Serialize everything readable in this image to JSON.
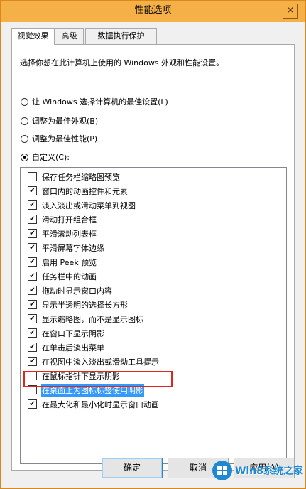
{
  "window": {
    "title": "性能选项",
    "close_glyph": "✕"
  },
  "tabs": [
    {
      "label": "视觉效果",
      "active": true
    },
    {
      "label": "高级",
      "active": false
    },
    {
      "label": "数据执行保护",
      "active": false
    }
  ],
  "intro_text": "选择你想在此计算机上使用的 Windows 外观和性能设置。",
  "radio_options": [
    {
      "label": "让 Windows 选择计算机的最佳设置(L)",
      "checked": false
    },
    {
      "label": "调整为最佳外观(B)",
      "checked": false
    },
    {
      "label": "调整为最佳性能(P)",
      "checked": false
    },
    {
      "label": "自定义(C):",
      "checked": true
    }
  ],
  "effects": [
    {
      "label": "保存任务栏缩略图预览",
      "checked": false
    },
    {
      "label": "窗口内的动画控件和元素",
      "checked": true
    },
    {
      "label": "淡入淡出或滑动菜单到视图",
      "checked": true
    },
    {
      "label": "滑动打开组合框",
      "checked": true
    },
    {
      "label": "平滑滚动列表框",
      "checked": true
    },
    {
      "label": "平滑屏幕字体边缘",
      "checked": true
    },
    {
      "label": "启用 Peek 预览",
      "checked": true
    },
    {
      "label": "任务栏中的动画",
      "checked": true
    },
    {
      "label": "拖动时显示窗口内容",
      "checked": true
    },
    {
      "label": "显示半透明的选择长方形",
      "checked": true
    },
    {
      "label": "显示缩略图，而不是显示图标",
      "checked": true
    },
    {
      "label": "在窗口下显示阴影",
      "checked": true
    },
    {
      "label": "在单击后淡出菜单",
      "checked": true
    },
    {
      "label": "在视图中淡入淡出或滑动工具提示",
      "checked": true
    },
    {
      "label": "在鼠标指针下显示阴影",
      "checked": false
    },
    {
      "label": "在桌面上为图标标签使用阴影",
      "checked": false,
      "selected": true
    },
    {
      "label": "在最大化和最小化时显示窗口动画",
      "checked": true
    }
  ],
  "buttons": {
    "ok": "确定",
    "cancel": "取消",
    "apply": "应用(A)"
  },
  "watermark": {
    "text": "Win8系统之家"
  },
  "colors": {
    "titlebar": "#f6b048",
    "selection": "#3399ff",
    "highlight_frame": "#e0251f"
  }
}
